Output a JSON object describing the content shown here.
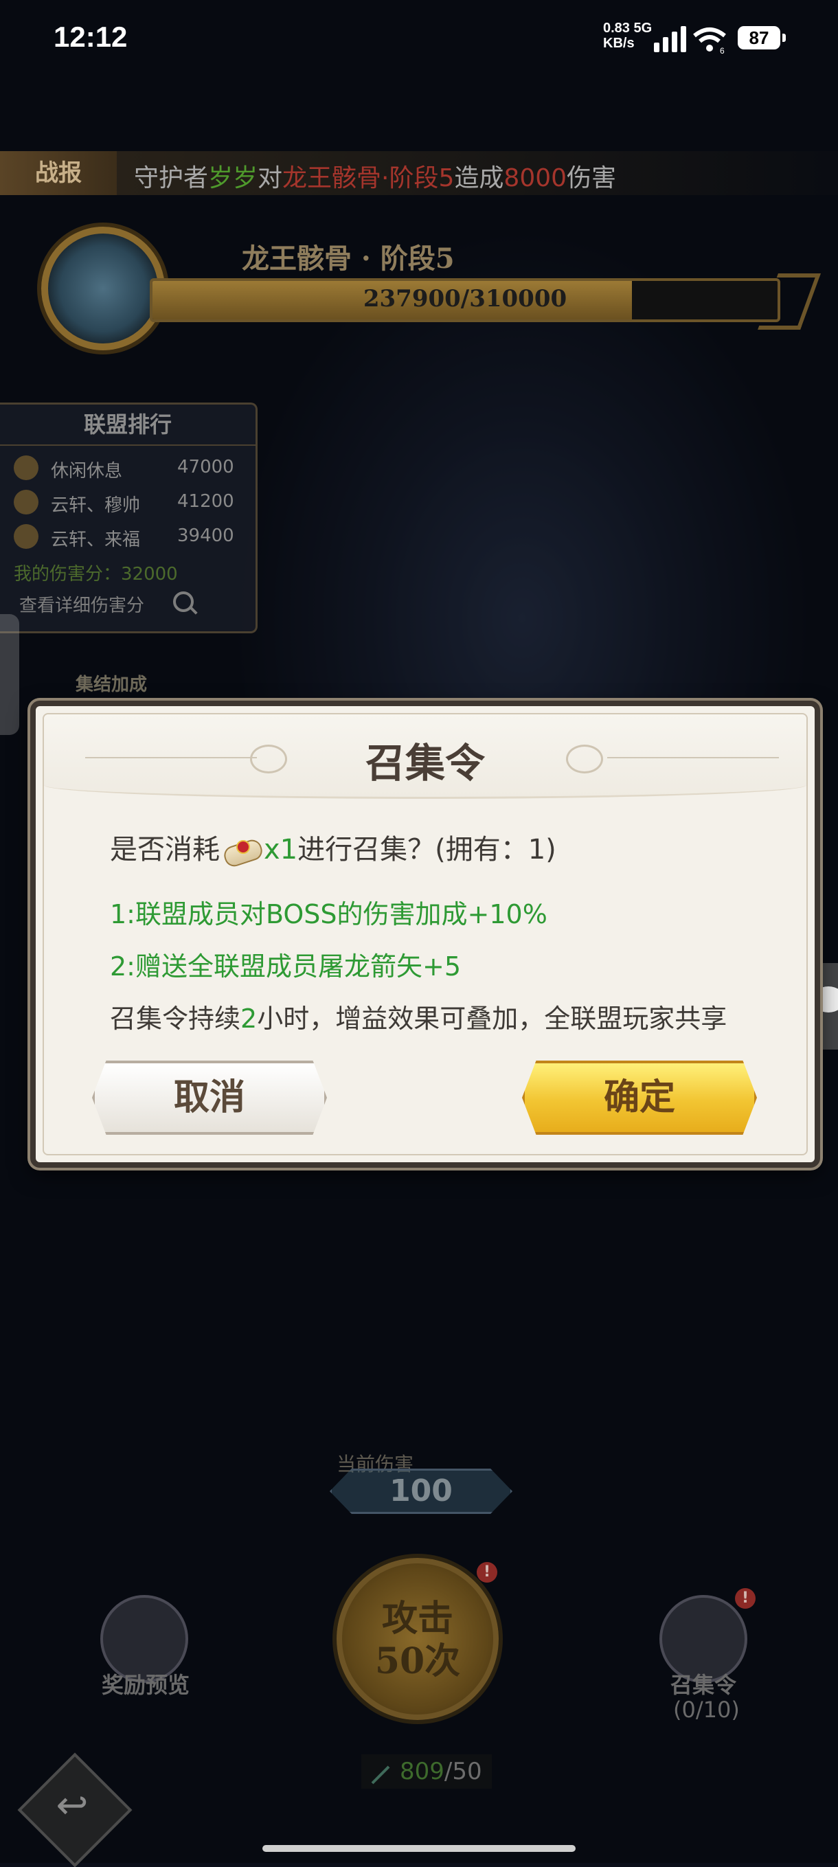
{
  "status_bar": {
    "time": "12:12",
    "net_speed_value": "0.83",
    "net_speed_unit": "KB/s",
    "network_type": "5G",
    "wifi_band": "6",
    "battery": "87"
  },
  "battle_report": {
    "tag": "战报",
    "prefix": "守护者",
    "player": "岁岁",
    "mid": "对",
    "target": "龙王骸骨·阶段5",
    "verb": "造成",
    "damage": "8000",
    "suffix": "伤害"
  },
  "boss": {
    "name": "龙王骸骨 · 阶段5",
    "hp_text": "237900/310000",
    "hp_current": 237900,
    "hp_max": 310000
  },
  "alliance_rank": {
    "title": "联盟排行",
    "rows": [
      {
        "name": "休闲休息",
        "score": "47000"
      },
      {
        "name": "云轩、穆帅",
        "score": "41200"
      },
      {
        "name": "云轩、来福",
        "score": "39400"
      }
    ],
    "my_damage": "我的伤害分：32000",
    "detail_link": "查看详细伤害分"
  },
  "rally_bonus": "集结加成",
  "dialog": {
    "title": "召集令",
    "question_prefix": "是否消耗",
    "question_qty": "x1",
    "question_suffix": "进行召集？(拥有：1)",
    "line1": "1:联盟成员对BOSS的伤害加成+10%",
    "line2": "2:赠送全联盟成员屠龙箭矢+5",
    "line3_prefix": "召集令持续",
    "line3_hours": "2",
    "line3_suffix": "小时，增益效果可叠加，全联盟玩家共享",
    "cancel_label": "取消",
    "confirm_label": "确定"
  },
  "bottom": {
    "current_damage_label": "当前伤害",
    "current_damage": "100",
    "attack_line1": "攻击",
    "attack_line2": "50次",
    "reward_label": "奖励预览",
    "rally_label": "召集令",
    "rally_count": "(0/10)",
    "arrows_current": "809",
    "arrows_sep": "/50",
    "alert": "!"
  },
  "colors": {
    "highlight_green": "#2e9a34",
    "confirm_gold": "#f2c532",
    "dialog_bg": "#f4f1ea"
  }
}
